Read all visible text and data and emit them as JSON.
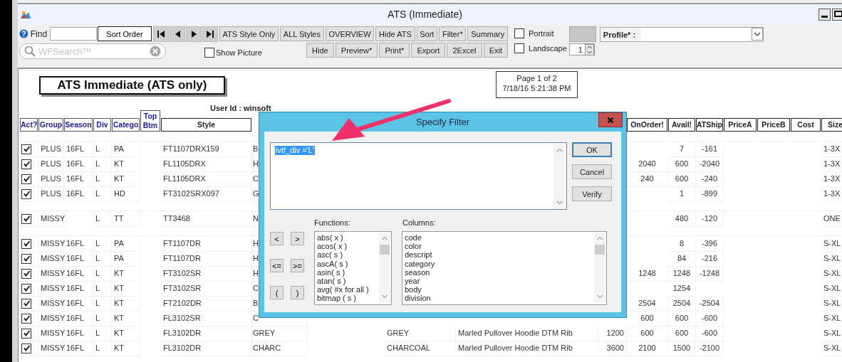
{
  "window": {
    "title": "ATS (Immediate)"
  },
  "toolbar": {
    "find_label": "Find",
    "sort_order": "Sort Order",
    "buttons_top": [
      "ATS Style Only",
      "ALL Styles",
      "OVERVIEW",
      "Hide ATS",
      "Sort",
      "Filter*",
      "Summary"
    ],
    "buttons_bottom": [
      "Hide",
      "Preview*",
      "Print*",
      "Export",
      "2Excel",
      "Exit"
    ],
    "search": {
      "placeholder": "WFSearch™"
    },
    "show_picture": {
      "label": "Show Picture",
      "checked": false
    },
    "orientation": [
      {
        "label": "Portrait",
        "checked": false
      },
      {
        "label": "Landscape",
        "checked": false
      }
    ],
    "copies": "1",
    "profile": {
      "label": "Profile* :"
    }
  },
  "report": {
    "title": "ATS Immediate (ATS only)",
    "page": "Page 1 of 2",
    "printed": "7/18/16 5:21:38 PM",
    "user": "User Id : winsoft"
  },
  "table": {
    "columns": [
      {
        "label": "Act?",
        "kind": "link"
      },
      {
        "label": "Group",
        "kind": "link"
      },
      {
        "label": "Season",
        "kind": "link"
      },
      {
        "label": "Div",
        "kind": "link"
      },
      {
        "label": "Catego",
        "kind": "link"
      },
      {
        "label": "Top Btm",
        "kind": "link"
      },
      {
        "label": "Style",
        "kind": "plain"
      },
      null,
      null,
      null,
      null,
      null,
      null,
      {
        "label": "OnOrder!",
        "kind": "plain"
      },
      {
        "label": "Avail!",
        "kind": "plain"
      },
      {
        "label": "ATShip",
        "kind": "plain"
      },
      {
        "label": "PriceA",
        "kind": "plain"
      },
      {
        "label": "PriceB",
        "kind": "plain"
      },
      {
        "label": "Cost",
        "kind": "plain"
      },
      {
        "label": "Size",
        "kind": "plain"
      }
    ],
    "rows": [
      {
        "kind": "gap"
      },
      {
        "kind": "item",
        "active": true,
        "cells": [
          "PLUS",
          "16FL",
          "L",
          "PA",
          null,
          "FT1107DRX159",
          "B",
          null,
          null,
          null,
          null,
          null,
          null,
          "7",
          "-161",
          null,
          null,
          null,
          "1-3X"
        ]
      },
      {
        "kind": "item",
        "active": true,
        "cells": [
          "PLUS",
          "16FL",
          "L",
          "KT",
          null,
          "FL1105DRX",
          "H",
          null,
          null,
          null,
          null,
          null,
          "2040",
          "600",
          "-2040",
          null,
          null,
          null,
          "1-3X"
        ]
      },
      {
        "kind": "item",
        "active": true,
        "cells": [
          "PLUS",
          "16FL",
          "L",
          "KT",
          null,
          "FL1105DRX",
          "C",
          null,
          null,
          null,
          null,
          null,
          "240",
          "600",
          "-240",
          null,
          null,
          null,
          "1-3X"
        ]
      },
      {
        "kind": "item",
        "active": true,
        "cells": [
          "PLUS",
          "16FL",
          "L",
          "HD",
          null,
          "FT3102SRX097",
          "G",
          null,
          null,
          null,
          null,
          null,
          null,
          "1",
          "-899",
          null,
          null,
          null,
          "1-3X"
        ]
      },
      {
        "kind": "gap"
      },
      {
        "kind": "item",
        "active": true,
        "cells": [
          "MISSY",
          null,
          "L",
          "TT",
          null,
          "TT3468",
          "N",
          null,
          null,
          null,
          null,
          null,
          null,
          "480",
          "-120",
          null,
          null,
          null,
          "ONE"
        ]
      },
      {
        "kind": "gap"
      },
      {
        "kind": "item",
        "active": true,
        "cells": [
          "MISSY",
          "16FL",
          "L",
          "PA",
          null,
          "FT1107DR",
          "H",
          null,
          null,
          null,
          null,
          null,
          null,
          "8",
          "-396",
          null,
          null,
          null,
          "S-XL"
        ]
      },
      {
        "kind": "item",
        "active": true,
        "cells": [
          "MISSY",
          "16FL",
          "L",
          "PA",
          null,
          "FT1107DR",
          "H",
          null,
          null,
          null,
          null,
          null,
          null,
          "84",
          "-216",
          null,
          null,
          null,
          "S-XL"
        ]
      },
      {
        "kind": "item",
        "active": true,
        "cells": [
          "MISSY",
          "16FL",
          "L",
          "KT",
          null,
          "FT3102SR",
          "H",
          null,
          null,
          null,
          null,
          null,
          "1248",
          "1248",
          "-1248",
          null,
          null,
          null,
          "S-XL"
        ]
      },
      {
        "kind": "item",
        "active": true,
        "cells": [
          "MISSY",
          "16FL",
          "L",
          "KT",
          null,
          "FT3102SR",
          "C",
          null,
          null,
          null,
          null,
          null,
          null,
          "1254",
          null,
          null,
          null,
          null,
          "S-XL"
        ]
      },
      {
        "kind": "item",
        "active": true,
        "cells": [
          "MISSY",
          "16FL",
          "L",
          "KT",
          null,
          "FT2102DR",
          "B",
          null,
          null,
          null,
          null,
          null,
          "2504",
          "2504",
          "-2504",
          null,
          null,
          null,
          "S-XL"
        ]
      },
      {
        "kind": "item",
        "active": true,
        "cells": [
          "MISSY",
          "16FL",
          "L",
          "KT",
          null,
          "FL3102SR",
          "C",
          null,
          null,
          null,
          null,
          null,
          "600",
          "600",
          "-600",
          null,
          null,
          null,
          "S-XL"
        ]
      },
      {
        "kind": "item",
        "active": true,
        "cells": [
          "MISSY",
          "16FL",
          "L",
          "KT",
          null,
          "FL3102DR",
          "GREY",
          null,
          null,
          "GREY",
          "Marled Pullover Hoodie DTM Rib",
          "1200",
          "600",
          "600",
          "-600",
          null,
          null,
          null,
          "S-XL"
        ]
      },
      {
        "kind": "item",
        "active": true,
        "cells": [
          "MISSY",
          "16FL",
          "L",
          "KT",
          null,
          "FL3102DR",
          "CHARC",
          null,
          null,
          "CHARCOAL",
          "Marled Pullover Hoodie DTM Rib",
          "3600",
          "2100",
          "1500",
          "-2100",
          null,
          null,
          null,
          "S-XL"
        ]
      }
    ]
  },
  "filter_dialog": {
    "title": "Specify Filter",
    "expression": "ivtf_div ='L'",
    "expression_selected": true,
    "buttons": [
      {
        "label": "OK",
        "default": true
      },
      {
        "label": "Cancel",
        "default": false
      },
      {
        "label": "Verify",
        "default": false
      }
    ],
    "operators": [
      "<",
      ">",
      "<=",
      ">=",
      "(",
      ")"
    ],
    "functions_label": "Functions:",
    "functions": [
      "abs( x )",
      "acos( x )",
      "asc( s )",
      "ascA( s )",
      "asin( s )",
      "atan( s )",
      "avg( #x for all )",
      "bitmap ( s )"
    ],
    "columns_label": "Columns:",
    "columns": [
      "code",
      "color",
      "descript",
      "category",
      "season",
      "year",
      "body",
      "division"
    ]
  }
}
